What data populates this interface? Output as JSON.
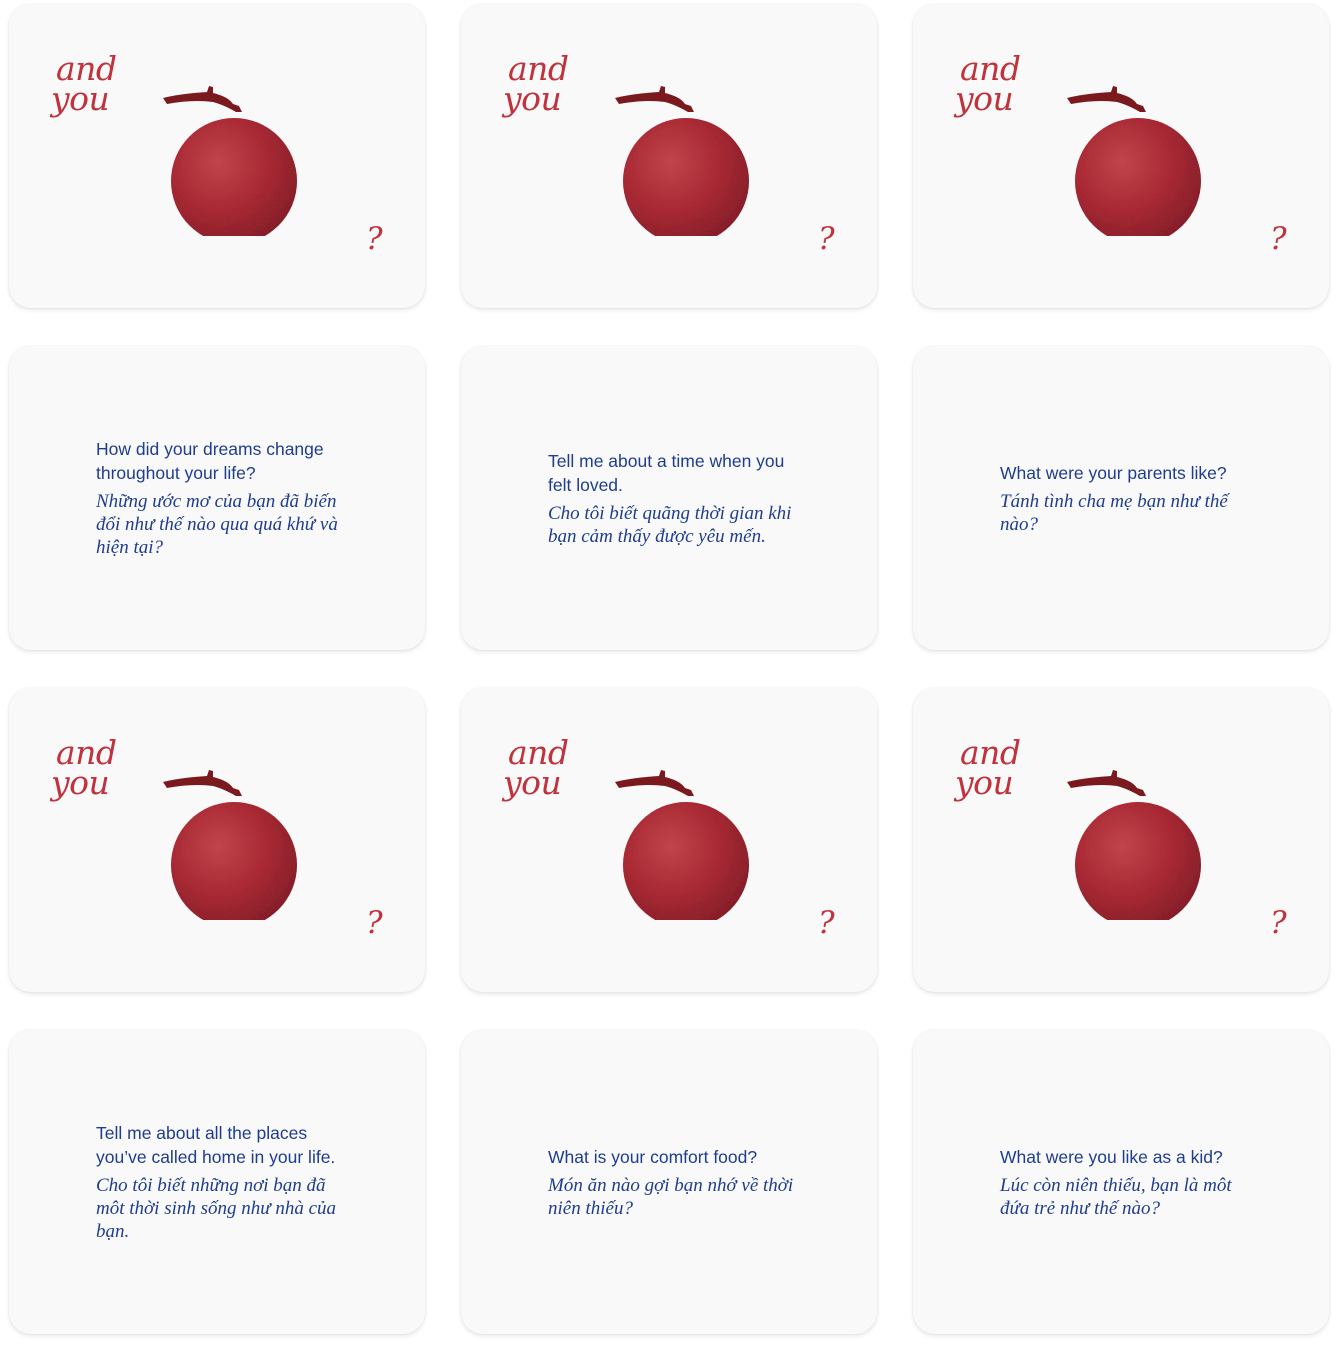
{
  "cover": {
    "line1": "and",
    "line2": "you",
    "mark": "?",
    "icon": "lychee-fruit-icon",
    "colors": {
      "accent": "#c0323c",
      "fruit": "#a8252d",
      "text": "#1e3d8f",
      "card": "#f9f9f9"
    }
  },
  "cards": [
    {
      "en": "How did your dreams change throughout your life?",
      "vi": "Những ước mơ của bạn đã biến đổi như thế nào qua quá khứ và hiện tại?"
    },
    {
      "en": "Tell me about a time when you felt loved.",
      "vi": "Cho tôi biết quãng thời gian khi bạn cảm thấy được yêu mến."
    },
    {
      "en": "What were your parents like?",
      "vi": "Tánh tình cha mẹ bạn như thế nào?"
    },
    {
      "en": "Tell me about all the places you’ve called home in your life.",
      "vi": "Cho tôi biết những nơi bạn đã môt thời sinh sống như nhà của bạn."
    },
    {
      "en": "What is your comfort food?",
      "vi": "Món ăn nào gợi bạn nhớ về thời niên thiếu?"
    },
    {
      "en": "What were you like as a kid?",
      "vi": "Lúc còn niên thiếu, bạn là môt đứa trẻ như thế nào?"
    }
  ]
}
